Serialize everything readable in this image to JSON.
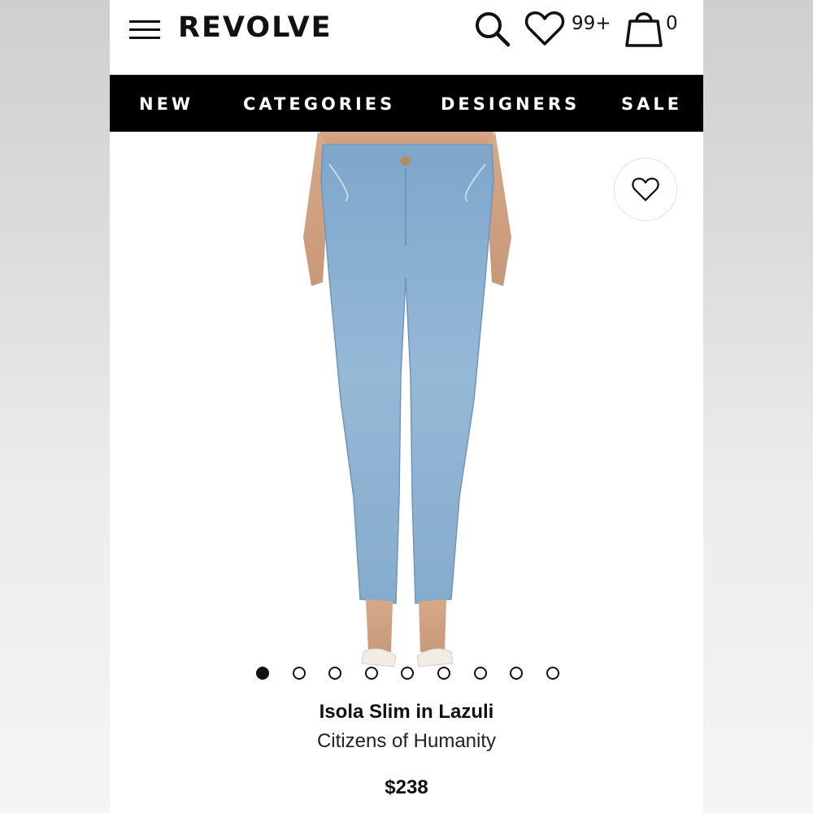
{
  "header": {
    "logo": "REVOLVE",
    "wishlist_count": "99+",
    "bag_count": "0",
    "icons": [
      "menu-icon",
      "search-icon",
      "heart-icon",
      "bag-icon"
    ]
  },
  "nav": {
    "items": [
      "NEW",
      "CATEGORIES",
      "DESIGNERS",
      "SALE"
    ]
  },
  "product": {
    "name": "Isola Slim in Lazuli",
    "brand": "Citizens of Humanity",
    "price": "$238",
    "image_count": 9,
    "active_image": 1,
    "denim_color": "#8fb3d3"
  },
  "colors": {
    "nav_background": "#000000",
    "text": "#111111"
  }
}
